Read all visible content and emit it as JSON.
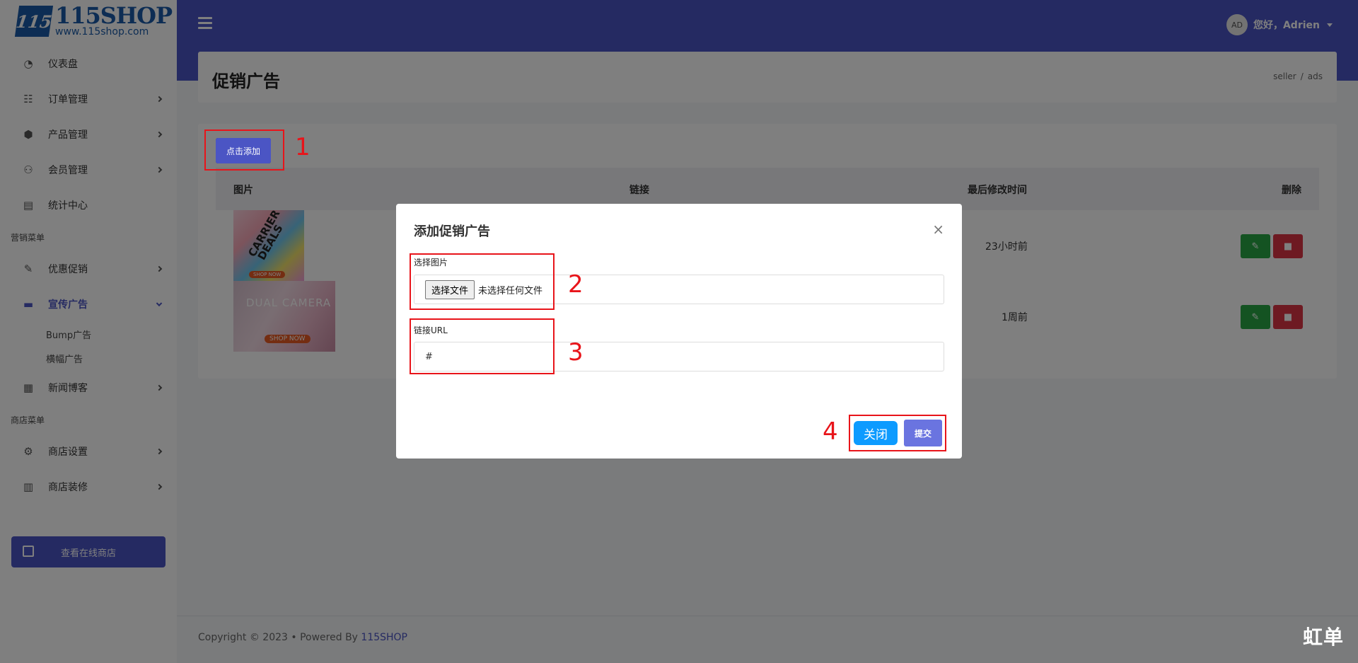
{
  "brand": {
    "logo_mark": "115",
    "title": "115SHOP",
    "url": "www.115shop.com"
  },
  "header": {
    "avatar": "AD",
    "greeting": "您好，Adrien"
  },
  "sidebar": {
    "items": [
      {
        "label": "仪表盘",
        "icon": "dashboard-icon"
      },
      {
        "label": "订单管理",
        "icon": "order-icon"
      },
      {
        "label": "产品管理",
        "icon": "product-icon"
      },
      {
        "label": "会员管理",
        "icon": "members-icon"
      },
      {
        "label": "统计中心",
        "icon": "stats-icon"
      }
    ],
    "section_marketing": "营销菜单",
    "marketing_items": [
      {
        "label": "优惠促销",
        "icon": "promo-icon"
      },
      {
        "label": "宣传广告",
        "icon": "ads-icon"
      }
    ],
    "ads_sub": [
      "Bump广告",
      "横幅广告"
    ],
    "news": {
      "label": "新闻博客",
      "icon": "news-icon"
    },
    "section_store": "商店菜单",
    "store_items": [
      {
        "label": "商店设置",
        "icon": "settings-icon"
      },
      {
        "label": "商店装修",
        "icon": "decor-icon"
      }
    ],
    "store_button": "查看在线商店"
  },
  "page": {
    "title": "促销广告",
    "breadcrumb": [
      "seller",
      "/",
      "ads"
    ]
  },
  "content": {
    "add_button": "点击添加",
    "columns": [
      "图片",
      "链接",
      "最后修改时间",
      "删除"
    ],
    "rows": [
      {
        "time": "23小时前",
        "image_text": "CARRIER DEALS",
        "image_badge": "SHOP NOW"
      },
      {
        "time": "1周前",
        "image_text": "DUAL CAMERA",
        "image_badge": "SHOP NOW"
      }
    ]
  },
  "modal": {
    "title": "添加促销广告",
    "close_symbol": "×",
    "image_label": "选择图片",
    "file_button": "选择文件",
    "file_status": "未选择任何文件",
    "url_label": "链接URL",
    "url_value": "#",
    "close_button": "关闭",
    "submit_button": "提交"
  },
  "annotations": [
    "1",
    "2",
    "3",
    "4"
  ],
  "footer": {
    "prefix": "Copyright © 2023  •  Powered By ",
    "brand": "115SHOP"
  },
  "watermark": "虹单"
}
